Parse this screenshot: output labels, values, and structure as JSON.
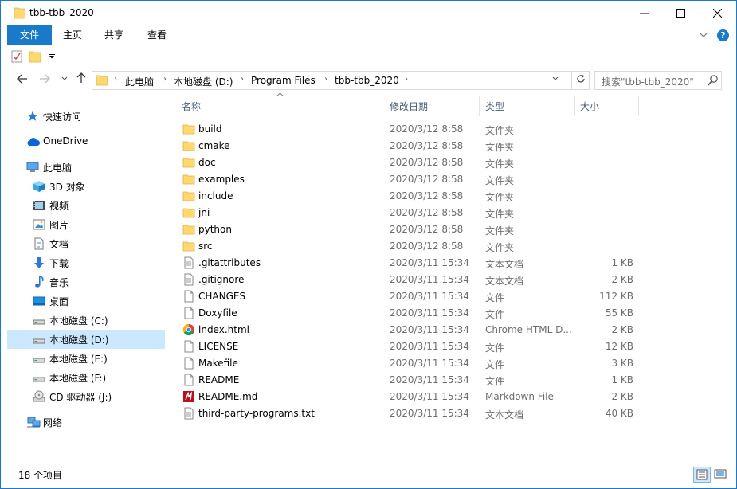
{
  "window": {
    "title": "tbb-tbb_2020",
    "controls": {
      "minimize": "—",
      "maximize": "☐",
      "close": "✕"
    }
  },
  "ribbon": {
    "tabs": [
      "文件",
      "主页",
      "共享",
      "查看"
    ],
    "help": "?"
  },
  "address": {
    "breadcrumbs": [
      "此电脑",
      "本地磁盘 (D:)",
      "Program Files",
      "tbb-tbb_2020"
    ]
  },
  "search": {
    "placeholder": "搜索\"tbb-tbb_2020\""
  },
  "nav_pane": {
    "items": [
      {
        "label": "快速访问",
        "icon": "star-icon"
      },
      {
        "label": "OneDrive",
        "icon": "cloud-icon"
      },
      {
        "label": "此电脑",
        "icon": "computer-icon"
      },
      {
        "label": "3D 对象",
        "icon": "cube-icon"
      },
      {
        "label": "视频",
        "icon": "video-icon"
      },
      {
        "label": "图片",
        "icon": "picture-icon"
      },
      {
        "label": "文档",
        "icon": "document-icon"
      },
      {
        "label": "下载",
        "icon": "download-icon"
      },
      {
        "label": "音乐",
        "icon": "music-icon"
      },
      {
        "label": "桌面",
        "icon": "desktop-icon"
      },
      {
        "label": "本地磁盘 (C:)",
        "icon": "drive-icon"
      },
      {
        "label": "本地磁盘 (D:)",
        "icon": "drive-icon",
        "selected": true
      },
      {
        "label": "本地磁盘 (E:)",
        "icon": "drive-icon"
      },
      {
        "label": "本地磁盘 (F:)",
        "icon": "drive-icon"
      },
      {
        "label": "CD 驱动器 (J:)",
        "icon": "cd-icon"
      },
      {
        "label": "网络",
        "icon": "network-icon"
      }
    ]
  },
  "columns": {
    "name": "名称",
    "date": "修改日期",
    "type": "类型",
    "size": "大小"
  },
  "files": [
    {
      "name": "build",
      "date": "2020/3/12 8:58",
      "type": "文件夹",
      "size": "",
      "icon": "folder-icon"
    },
    {
      "name": "cmake",
      "date": "2020/3/12 8:58",
      "type": "文件夹",
      "size": "",
      "icon": "folder-icon"
    },
    {
      "name": "doc",
      "date": "2020/3/12 8:58",
      "type": "文件夹",
      "size": "",
      "icon": "folder-icon"
    },
    {
      "name": "examples",
      "date": "2020/3/12 8:58",
      "type": "文件夹",
      "size": "",
      "icon": "folder-icon"
    },
    {
      "name": "include",
      "date": "2020/3/12 8:58",
      "type": "文件夹",
      "size": "",
      "icon": "folder-icon"
    },
    {
      "name": "jni",
      "date": "2020/3/12 8:58",
      "type": "文件夹",
      "size": "",
      "icon": "folder-icon"
    },
    {
      "name": "python",
      "date": "2020/3/12 8:58",
      "type": "文件夹",
      "size": "",
      "icon": "folder-icon"
    },
    {
      "name": "src",
      "date": "2020/3/12 8:58",
      "type": "文件夹",
      "size": "",
      "icon": "folder-icon"
    },
    {
      "name": ".gitattributes",
      "date": "2020/3/11 15:34",
      "type": "文本文档",
      "size": "1 KB",
      "icon": "text-file-icon"
    },
    {
      "name": ".gitignore",
      "date": "2020/3/11 15:34",
      "type": "文本文档",
      "size": "2 KB",
      "icon": "text-file-icon"
    },
    {
      "name": "CHANGES",
      "date": "2020/3/11 15:34",
      "type": "文件",
      "size": "112 KB",
      "icon": "file-icon"
    },
    {
      "name": "Doxyfile",
      "date": "2020/3/11 15:34",
      "type": "文件",
      "size": "55 KB",
      "icon": "file-icon"
    },
    {
      "name": "index.html",
      "date": "2020/3/11 15:34",
      "type": "Chrome HTML D...",
      "size": "2 KB",
      "icon": "chrome-icon"
    },
    {
      "name": "LICENSE",
      "date": "2020/3/11 15:34",
      "type": "文件",
      "size": "12 KB",
      "icon": "file-icon"
    },
    {
      "name": "Makefile",
      "date": "2020/3/11 15:34",
      "type": "文件",
      "size": "3 KB",
      "icon": "file-icon"
    },
    {
      "name": "README",
      "date": "2020/3/11 15:34",
      "type": "文件",
      "size": "1 KB",
      "icon": "file-icon"
    },
    {
      "name": "README.md",
      "date": "2020/3/11 15:34",
      "type": "Markdown File",
      "size": "2 KB",
      "icon": "markdown-icon"
    },
    {
      "name": "third-party-programs.txt",
      "date": "2020/3/11 15:34",
      "type": "文本文档",
      "size": "40 KB",
      "icon": "text-file-icon"
    }
  ],
  "status": {
    "count": "18 个项目"
  },
  "colors": {
    "accent": "#1979ca",
    "selection": "#cce8ff",
    "folder": "#ffd86e",
    "muted_text": "#6d6d6d"
  }
}
